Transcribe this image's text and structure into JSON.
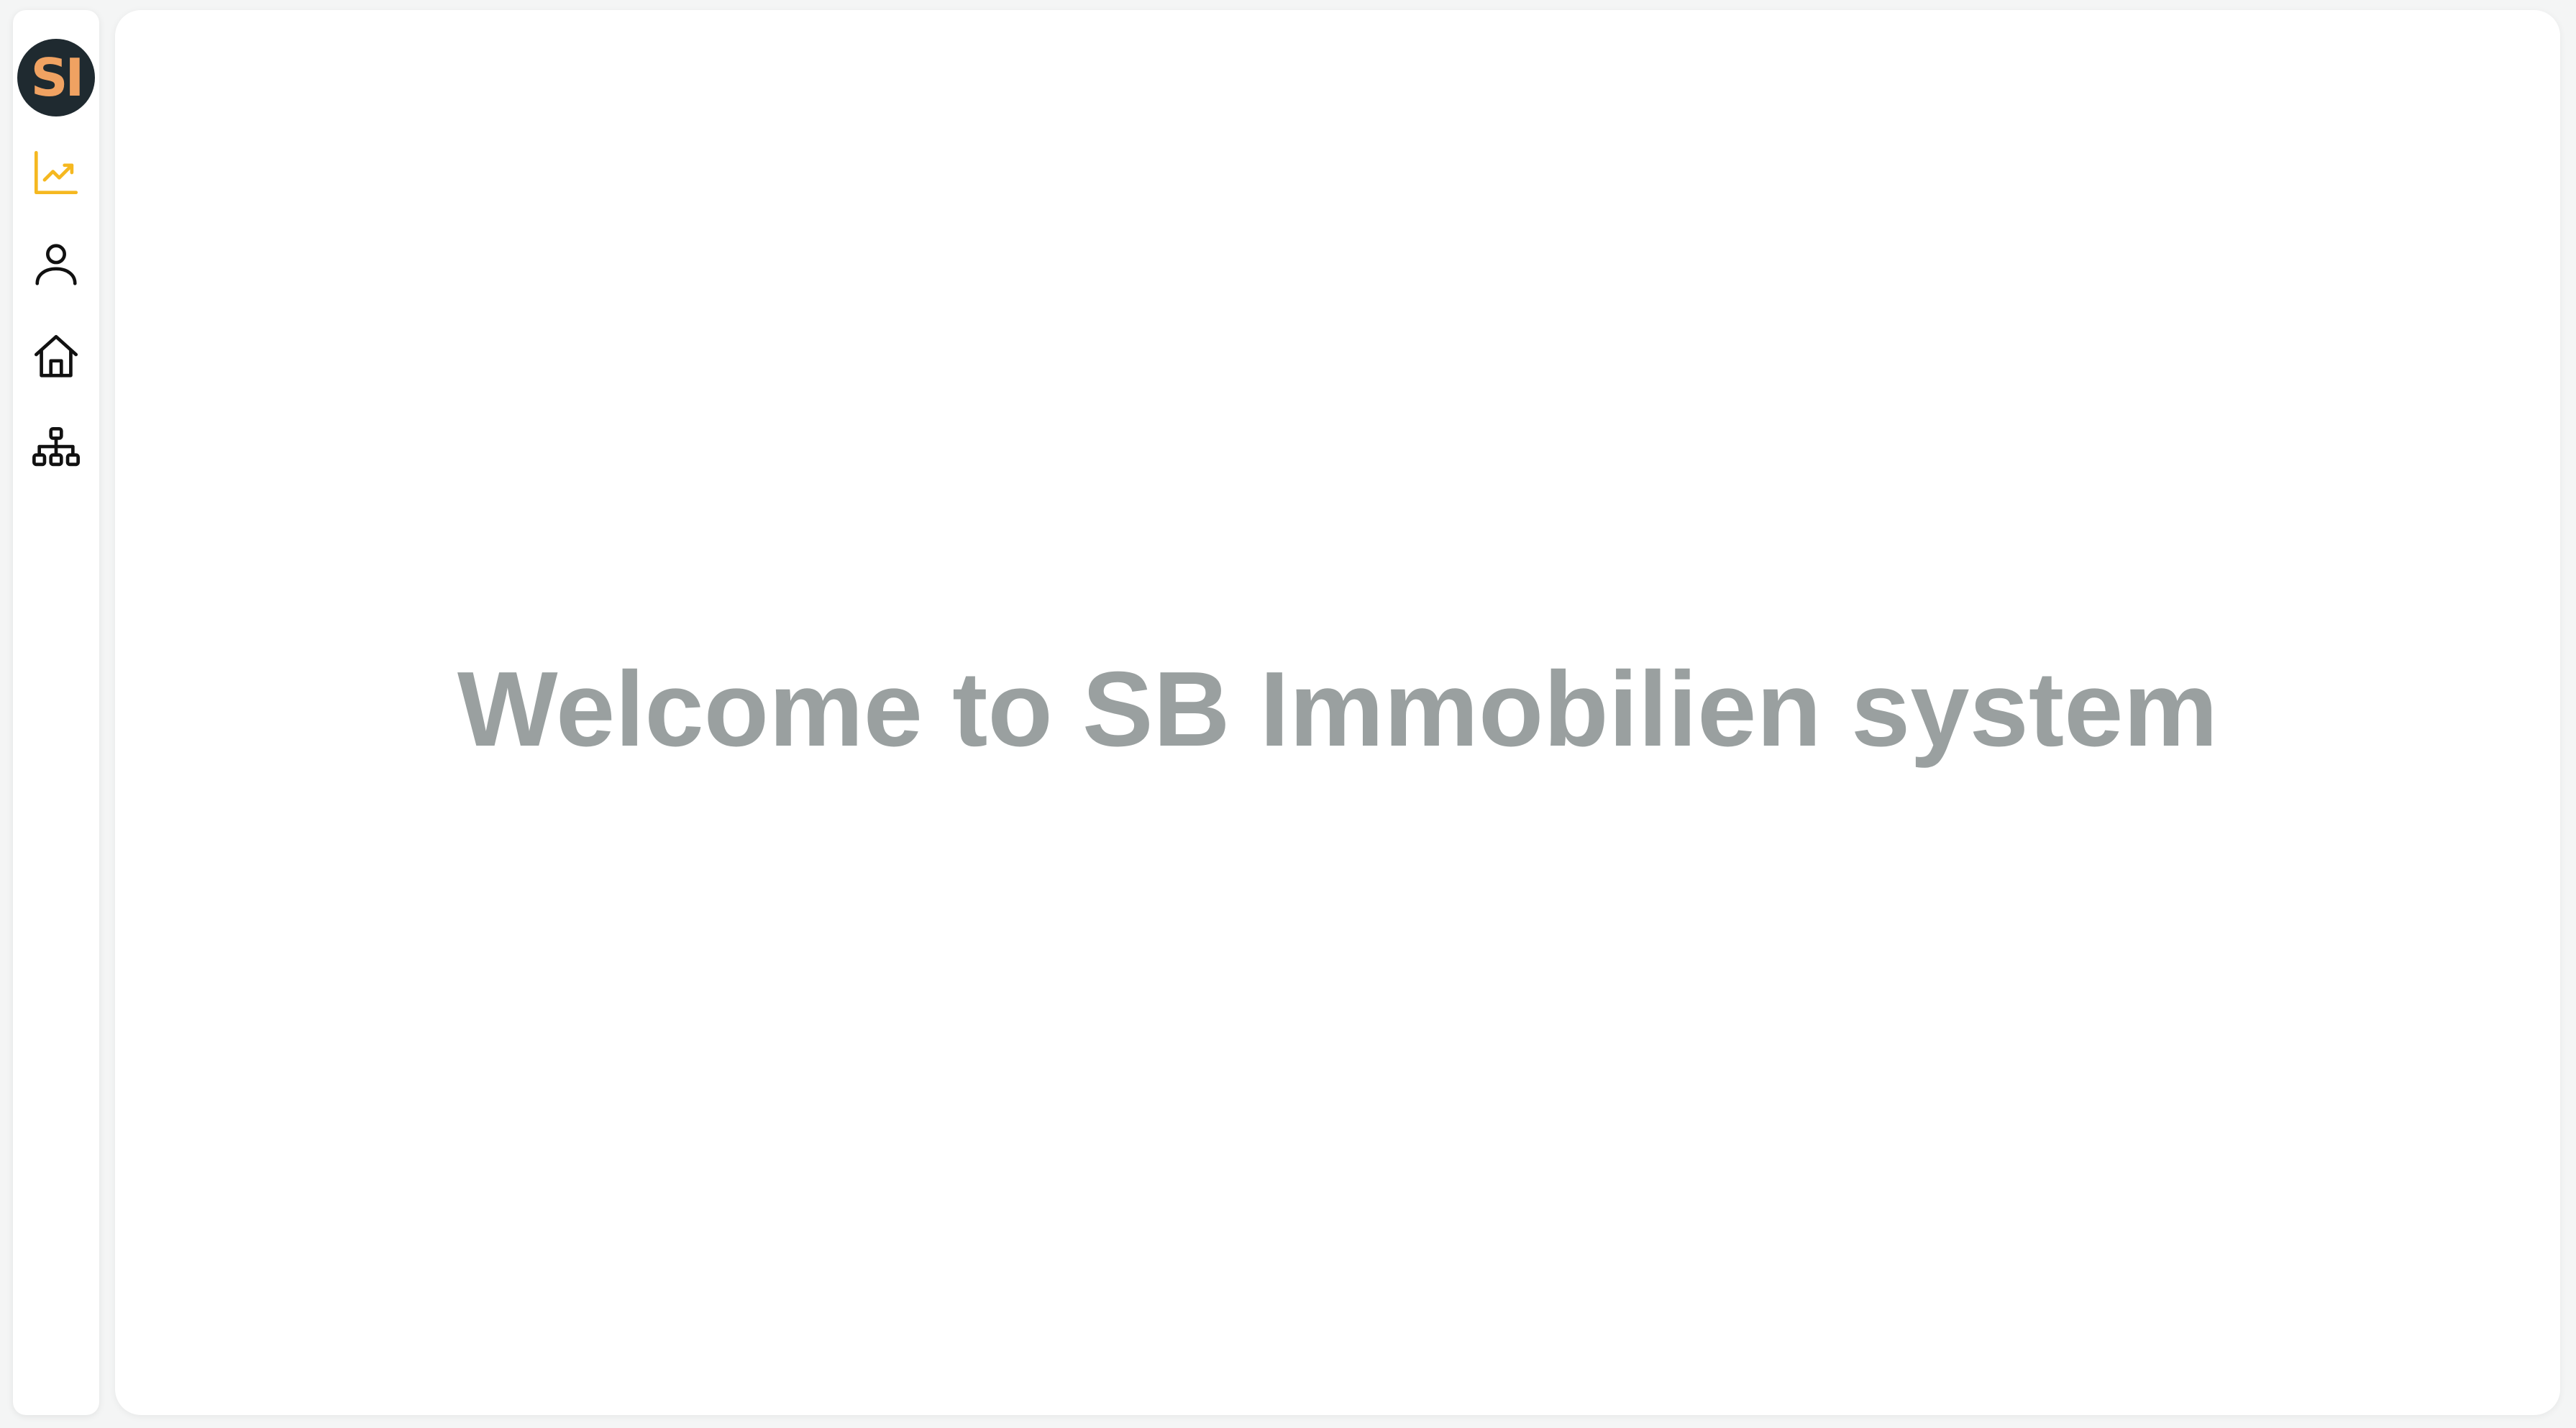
{
  "logo": {
    "text": "SI",
    "background": "#1f2a30",
    "color": "#f0a262"
  },
  "sidebar": {
    "items": [
      {
        "icon": "trending-chart-icon",
        "active": true,
        "color": "#f5b820"
      },
      {
        "icon": "user-icon",
        "active": false,
        "color": "#111111"
      },
      {
        "icon": "home-icon",
        "active": false,
        "color": "#111111"
      },
      {
        "icon": "sitemap-icon",
        "active": false,
        "color": "#111111"
      }
    ]
  },
  "main": {
    "welcome_text": "Welcome to SB Immobilien system",
    "text_color": "#9aa0a0"
  }
}
